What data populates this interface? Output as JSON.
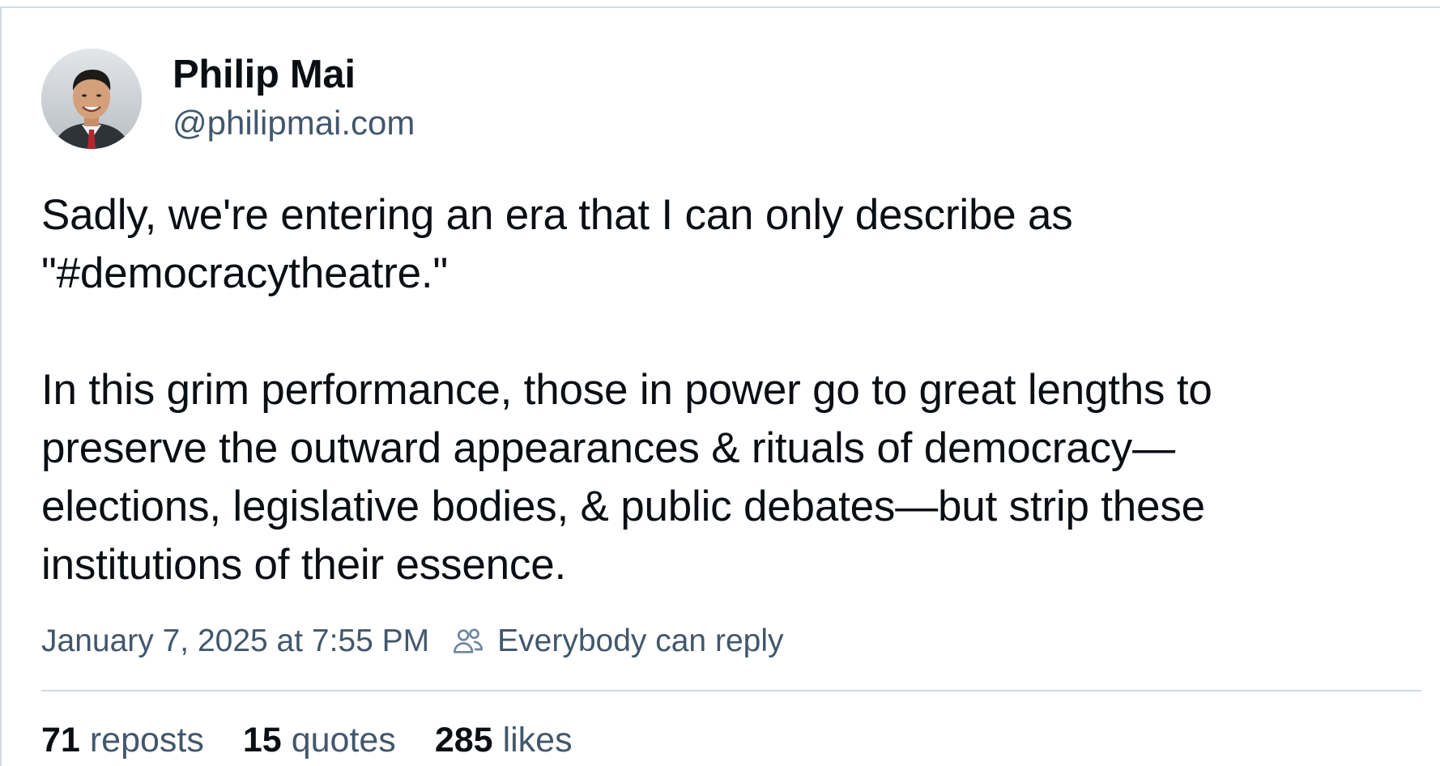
{
  "post": {
    "author": {
      "display_name": "Philip Mai",
      "handle": "@philipmai.com",
      "avatar_icon": "user-avatar-photo"
    },
    "paragraphs": [
      "Sadly, we're entering an era that I can only describe as\n\"#democracytheatre.\"",
      "In this grim performance, those in power go to great lengths to\npreserve the outward appearances & rituals of democracy—\nelections, legislative bodies, & public debates—but strip these\ninstitutions of their essence."
    ],
    "timestamp": "January 7, 2025 at 7:55 PM",
    "reply_setting": {
      "icon": "people-icon",
      "label": "Everybody can reply"
    },
    "stats": {
      "reposts": {
        "count": "71",
        "label": "reposts"
      },
      "quotes": {
        "count": "15",
        "label": "quotes"
      },
      "likes": {
        "count": "285",
        "label": "likes"
      }
    }
  },
  "colors": {
    "text_primary": "#0b0f14",
    "text_secondary": "#42576c",
    "border": "#d4dbe2",
    "background": "#ffffff"
  }
}
